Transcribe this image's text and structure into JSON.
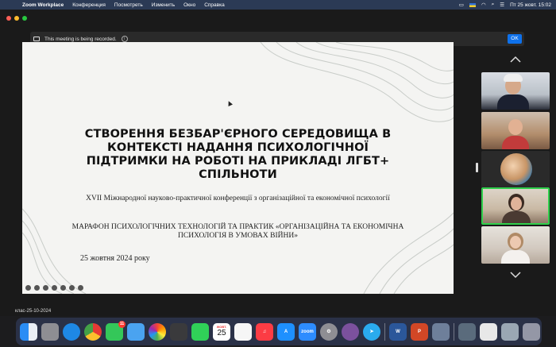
{
  "menubar": {
    "app_name": "Zoom Workplace",
    "items": [
      "Конференция",
      "Посмотреть",
      "Изменить",
      "Окно",
      "Справка"
    ],
    "datetime": "Пт 25 жовт.  15:02"
  },
  "recording_banner": {
    "message": "This meeting is being recorded.",
    "ok_label": "OK"
  },
  "slide": {
    "title": "СТВОРЕННЯ БЕЗБАР'ЄРНОГО СЕРЕДОВИЩА В КОНТЕКСТІ НАДАННЯ ПСИХОЛОГІЧНОЇ ПІДТРИМКИ НА РОБОТІ НА ПРИКЛАДІ ЛГБТ+ СПІЛЬНОТИ",
    "subtitle_1": "XVII Міжнародної науково-практичної конференції з організаційної та економічної психології",
    "subtitle_2": "МАРАФОН ПСИХОЛОГІЧНИХ ТЕХНОЛОГІЙ ТА ПРАКТИК «ОРГАНІЗАЦІЙНА ТА ЕКОНОМІЧНА ПСИХОЛОГІЯ В УМОВАХ ВІЙНИ»",
    "date": "25 жовтня 2024 року"
  },
  "window_label": "клас-25-10-2024",
  "dock": {
    "mail_badge": "11",
    "calendar_month": "ЖОВТ.",
    "calendar_day": "25",
    "zoom_label": "zoom"
  },
  "colors": {
    "accent": "#0e71eb",
    "active_speaker": "#2fcf4b"
  }
}
